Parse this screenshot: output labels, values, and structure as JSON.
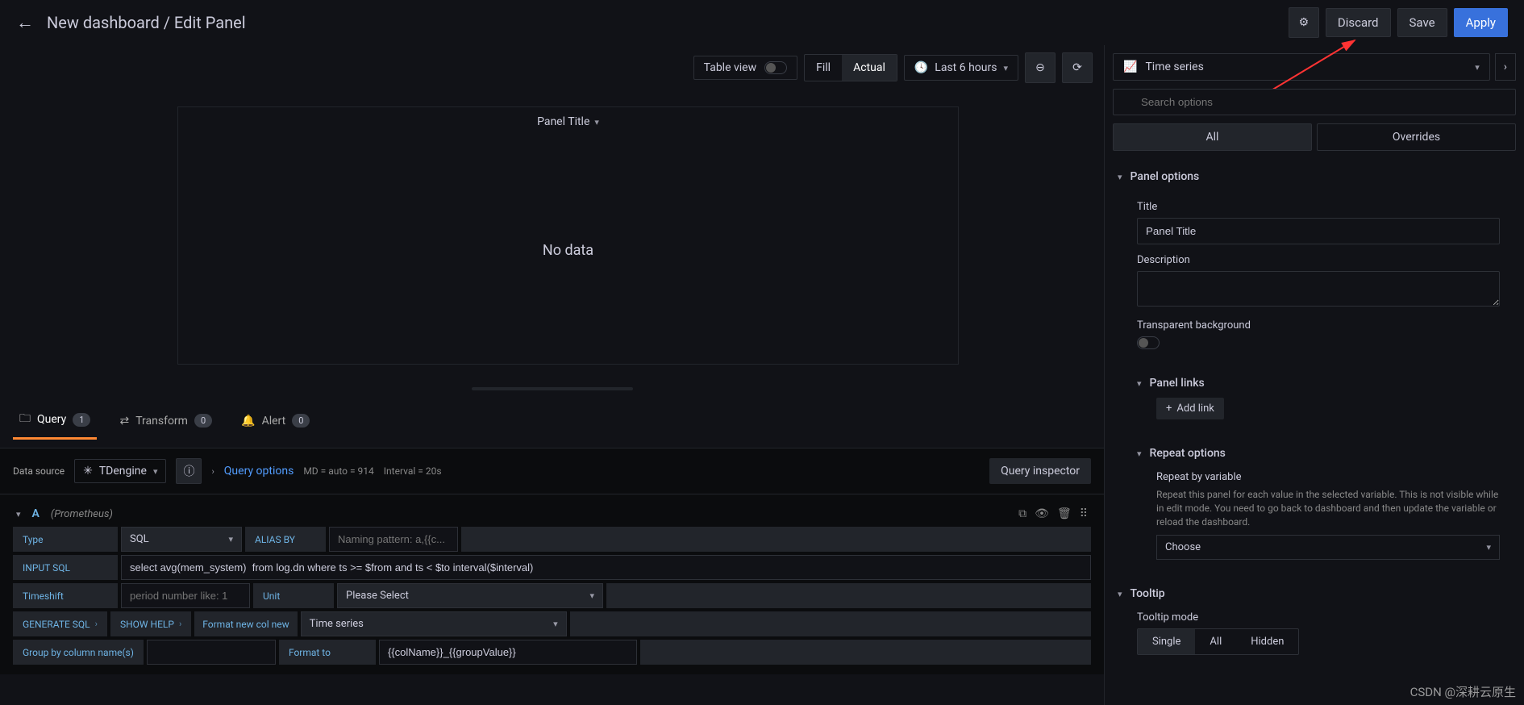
{
  "breadcrumb": "New dashboard / Edit Panel",
  "header_buttons": {
    "discard": "Discard",
    "save": "Save",
    "apply": "Apply"
  },
  "toolbar": {
    "table_view": "Table view",
    "fill": "Fill",
    "actual": "Actual",
    "time_range": "Last 6 hours"
  },
  "panel": {
    "title": "Panel Title",
    "empty_text": "No data"
  },
  "tabs": {
    "query": "Query",
    "query_count": "1",
    "transform": "Transform",
    "transform_count": "0",
    "alert": "Alert",
    "alert_count": "0"
  },
  "ds_row": {
    "label": "Data source",
    "datasource": "TDengine",
    "query_options": "Query options",
    "meta_md": "MD = auto = 914",
    "meta_interval": "Interval = 20s",
    "inspector": "Query inspector"
  },
  "query": {
    "ref_id": "A",
    "ds_name": "(Prometheus)",
    "type_label": "Type",
    "type_value": "SQL",
    "alias_label": "ALIAS BY",
    "alias_placeholder": "Naming pattern: a,{{c...",
    "input_sql_label": "INPUT SQL",
    "input_sql_value": "select avg(mem_system)  from log.dn where ts >= $from and ts < $to interval($interval)",
    "timeshift_label": "Timeshift",
    "timeshift_placeholder": "period number like: 1",
    "unit_label": "Unit",
    "unit_value": "Please Select",
    "generate_sql": "GENERATE SQL",
    "show_help": "SHOW HELP",
    "format_label": "Format new col new",
    "format_value": "Time series",
    "group_by_label": "Group by column name(s)",
    "format_to_label": "Format to",
    "format_to_value": "{{colName}}_{{groupValue}}"
  },
  "sidebar": {
    "viz_type": "Time series",
    "search_placeholder": "Search options",
    "tab_all": "All",
    "tab_overrides": "Overrides",
    "panel_options": {
      "header": "Panel options",
      "title_label": "Title",
      "title_value": "Panel Title",
      "desc_label": "Description",
      "transparent_label": "Transparent background"
    },
    "panel_links": {
      "header": "Panel links",
      "add_link": "Add link"
    },
    "repeat": {
      "header": "Repeat options",
      "var_label": "Repeat by variable",
      "var_desc": "Repeat this panel for each value in the selected variable. This is not visible while in edit mode. You need to go back to dashboard and then update the variable or reload the dashboard.",
      "choose": "Choose"
    },
    "tooltip": {
      "header": "Tooltip",
      "mode_label": "Tooltip mode",
      "single": "Single",
      "all": "All",
      "hidden": "Hidden"
    }
  },
  "watermark": "CSDN @深耕云原生"
}
